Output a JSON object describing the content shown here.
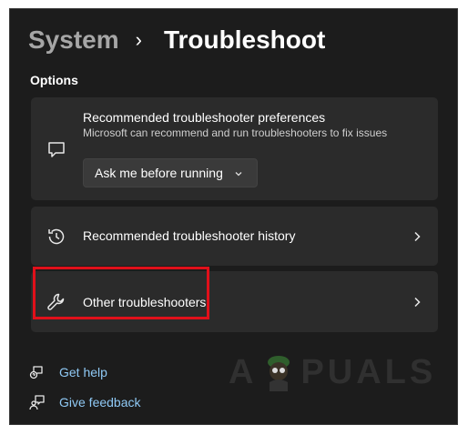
{
  "breadcrumb": {
    "parent": "System",
    "separator": "›",
    "current": "Troubleshoot"
  },
  "section_title": "Options",
  "cards": {
    "preferences": {
      "title": "Recommended troubleshooter preferences",
      "subtitle": "Microsoft can recommend and run troubleshooters to fix issues",
      "icon": "chat-bubble-icon",
      "dropdown_value": "Ask me before running"
    },
    "history": {
      "title": "Recommended troubleshooter history",
      "icon": "history-icon"
    },
    "other": {
      "title": "Other troubleshooters",
      "icon": "wrench-icon"
    }
  },
  "links": {
    "get_help": "Get help",
    "give_feedback": "Give feedback"
  },
  "watermark": {
    "left": "A",
    "right": "PUALS"
  },
  "colors": {
    "background": "#1c1c1c",
    "card": "#2b2b2b",
    "link": "#8fc9f5",
    "highlight": "#e0101a"
  }
}
